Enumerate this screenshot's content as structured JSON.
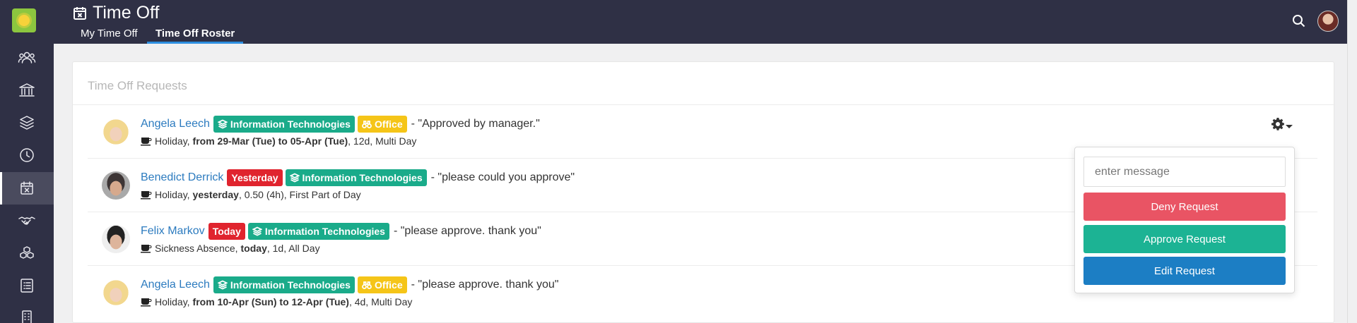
{
  "header": {
    "title": "Time Off",
    "tabs": [
      {
        "label": "My Time Off",
        "active": false
      },
      {
        "label": "Time Off Roster",
        "active": true
      }
    ]
  },
  "sidebar": {
    "items": [
      {
        "icon": "users-icon",
        "active": false
      },
      {
        "icon": "bank-icon",
        "active": false
      },
      {
        "icon": "layers-icon",
        "active": false
      },
      {
        "icon": "clock-icon",
        "active": false
      },
      {
        "icon": "calendar-x-icon",
        "active": true
      },
      {
        "icon": "handshake-icon",
        "active": false
      },
      {
        "icon": "cubes-icon",
        "active": false
      },
      {
        "icon": "checklist-icon",
        "active": false
      },
      {
        "icon": "building-icon",
        "active": false
      }
    ]
  },
  "card": {
    "title": "Time Off Requests"
  },
  "requests": [
    {
      "name": "Angela Leech",
      "badges": [
        {
          "text": "Information Technologies",
          "kind": "department"
        },
        {
          "text": "Office",
          "kind": "office"
        }
      ],
      "comment": "- \"Approved by manager.\"",
      "type": "Holiday,",
      "period": "from 29-Mar (Tue) to 05-Apr (Tue)",
      "details": ", 12d, Multi Day"
    },
    {
      "name": "Benedict Derrick",
      "badges": [
        {
          "text": "Yesterday",
          "kind": "date"
        },
        {
          "text": "Information Technologies",
          "kind": "department"
        }
      ],
      "comment": "- \"please could you approve\"",
      "type": "Holiday,",
      "period": "yesterday",
      "details": ", 0.50 (4h), First Part of Day"
    },
    {
      "name": "Felix Markov",
      "badges": [
        {
          "text": "Today",
          "kind": "date"
        },
        {
          "text": "Information Technologies",
          "kind": "department"
        }
      ],
      "comment": "- \"please approve. thank you\"",
      "type": "Sickness Absence,",
      "period": "today",
      "details": ", 1d, All Day"
    },
    {
      "name": "Angela Leech",
      "badges": [
        {
          "text": "Information Technologies",
          "kind": "department"
        },
        {
          "text": "Office",
          "kind": "office"
        }
      ],
      "comment": "- \"please approve. thank you\"",
      "type": "Holiday,",
      "period": "from 10-Apr (Sun) to 12-Apr (Tue)",
      "details": ", 4d, Multi Day"
    }
  ],
  "dropdown": {
    "message_placeholder": "enter message",
    "deny_label": "Deny Request",
    "approve_label": "Approve Request",
    "edit_label": "Edit Request"
  },
  "colors": {
    "topbar": "#2f3045",
    "department_badge": "#1aab8a",
    "office_badge": "#f5c518",
    "date_badge": "#e0242e",
    "deny": "#e95464",
    "approve": "#1cb394",
    "edit": "#1c7ec4",
    "link": "#2c7bbf"
  }
}
